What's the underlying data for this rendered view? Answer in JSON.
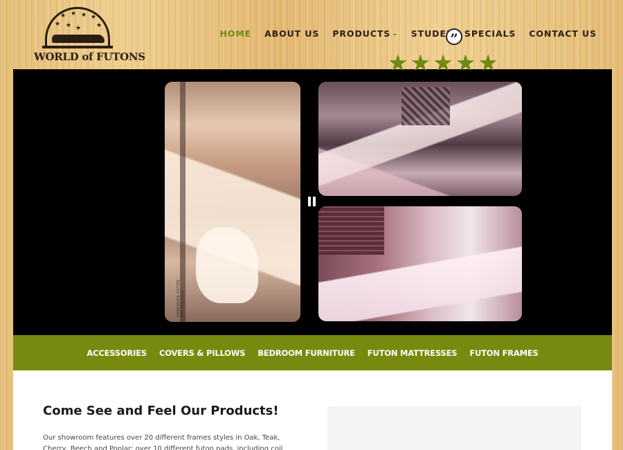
{
  "header": {
    "logo_text": "WORLD of FUTONS",
    "nav": [
      {
        "label": "HOME",
        "active": true
      },
      {
        "label": "ABOUT US"
      },
      {
        "label": "PRODUCTS",
        "has_dropdown": true,
        "dropdown_icon": "chevron-down-icon"
      },
      {
        "label": "STUDENT SPECIALS"
      },
      {
        "label": "CONTACT US"
      }
    ]
  },
  "slider": {
    "caption": "HANDMADE FUTON MATTRESSES",
    "pause_icon": "pause-icon"
  },
  "categories": [
    "ACCESSORIES",
    "COVERS & PILLOWS",
    "BEDROOM FURNITURE",
    "FUTON MATTRESSES",
    "FUTON FRAMES"
  ],
  "main": {
    "heading": "Come See and Feel Our Products!",
    "paragraph": "Our showroom features over 20 different frames styles in Oak, Teak, Cherry, Beech and Poplar; over 10 different futon pads, including coil springs, wool",
    "testimonial": {
      "quote_icon": "quote-icon",
      "rating": 5,
      "max_rating": 5
    }
  },
  "colors": {
    "accent_green": "#778a0f",
    "nav_active": "#6f8a12",
    "star": "#6d8a12"
  }
}
